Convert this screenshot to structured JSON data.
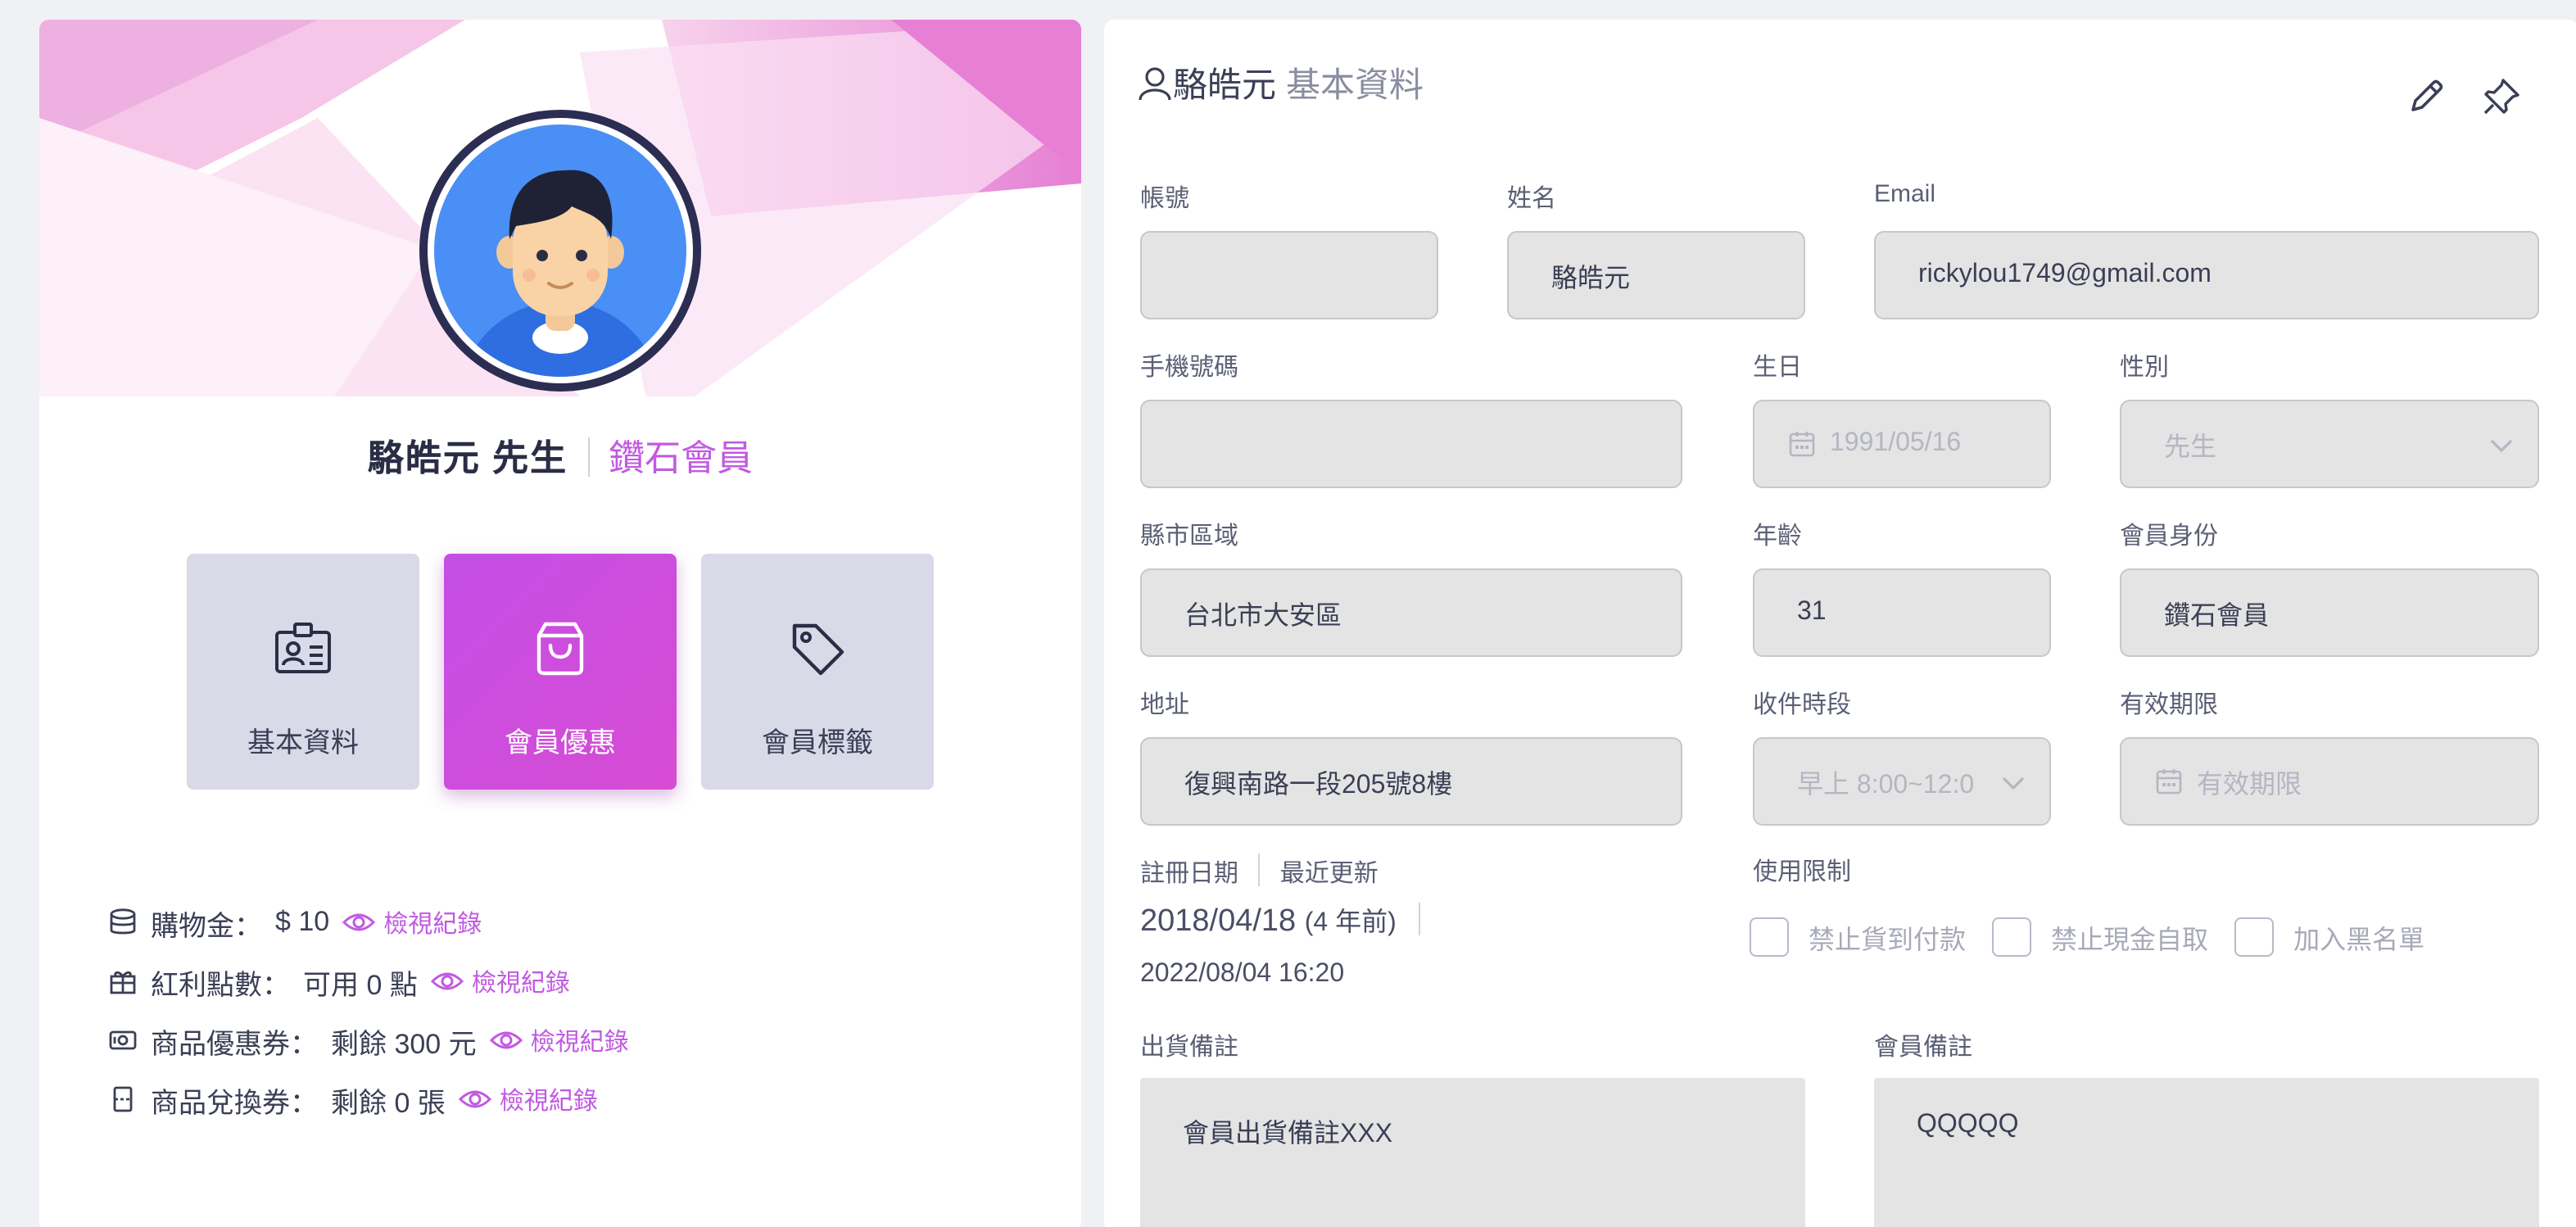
{
  "profile": {
    "name": "駱皓元 先生",
    "tier": "鑽石會員"
  },
  "tiles": [
    {
      "label": "基本資料",
      "icon": "id-card-icon"
    },
    {
      "label": "會員優惠",
      "icon": "shopping-bag-icon",
      "active": true
    },
    {
      "label": "會員標籤",
      "icon": "tag-icon"
    }
  ],
  "stats": {
    "credit": {
      "label": "購物金：",
      "value": "$ 10",
      "link": "檢視紀錄"
    },
    "points": {
      "label": "紅利點數：",
      "value": "可用 0 點",
      "link": "檢視紀錄"
    },
    "coupons": {
      "label": "商品優惠券：",
      "value": "剩餘 300 元",
      "link": "檢視紀錄"
    },
    "vouchers": {
      "label": "商品兌換券：",
      "value": "剩餘 0 張",
      "link": "檢視紀錄"
    }
  },
  "detail": {
    "title_name": "駱皓元",
    "title_sub": "基本資料",
    "labels": {
      "account": "帳號",
      "name": "姓名",
      "email": "Email",
      "phone": "手機號碼",
      "birthday": "生日",
      "gender": "性別",
      "region": "縣市區域",
      "age": "年齡",
      "member_level": "會員身份",
      "address": "地址",
      "delivery_time": "收件時段",
      "expiry": "有效期限",
      "register_date": "註冊日期",
      "last_update": "最近更新",
      "restrictions": "使用限制",
      "shipping_note": "出貨備註",
      "member_note": "會員備註"
    },
    "values": {
      "account": "",
      "name": "駱皓元",
      "email": "rickylou1749@gmail.com",
      "phone": "",
      "birthday": "1991/05/16",
      "gender": "先生",
      "region": "台北市大安區",
      "age": "31",
      "member_level": "鑽石會員",
      "address": "復興南路一段205號8樓",
      "delivery_time": "早上 8:00~12:0",
      "expiry_placeholder": "有效期限",
      "register_date": "2018/04/18",
      "register_ago": "(4 年前)",
      "last_update": "2022/08/04 16:20",
      "shipping_note": "會員出貨備註XXX",
      "member_note": "QQQQQ"
    },
    "restrictions": [
      {
        "label": "禁止貨到付款",
        "checked": false
      },
      {
        "label": "禁止現金自取",
        "checked": false
      },
      {
        "label": "加入黑名單",
        "checked": false
      }
    ]
  },
  "colors": {
    "accent": "#c15ae2",
    "field_bg": "#e4e4e4",
    "tile_bg": "#d8dae8",
    "avatar_bg": "#4a8ff5"
  }
}
